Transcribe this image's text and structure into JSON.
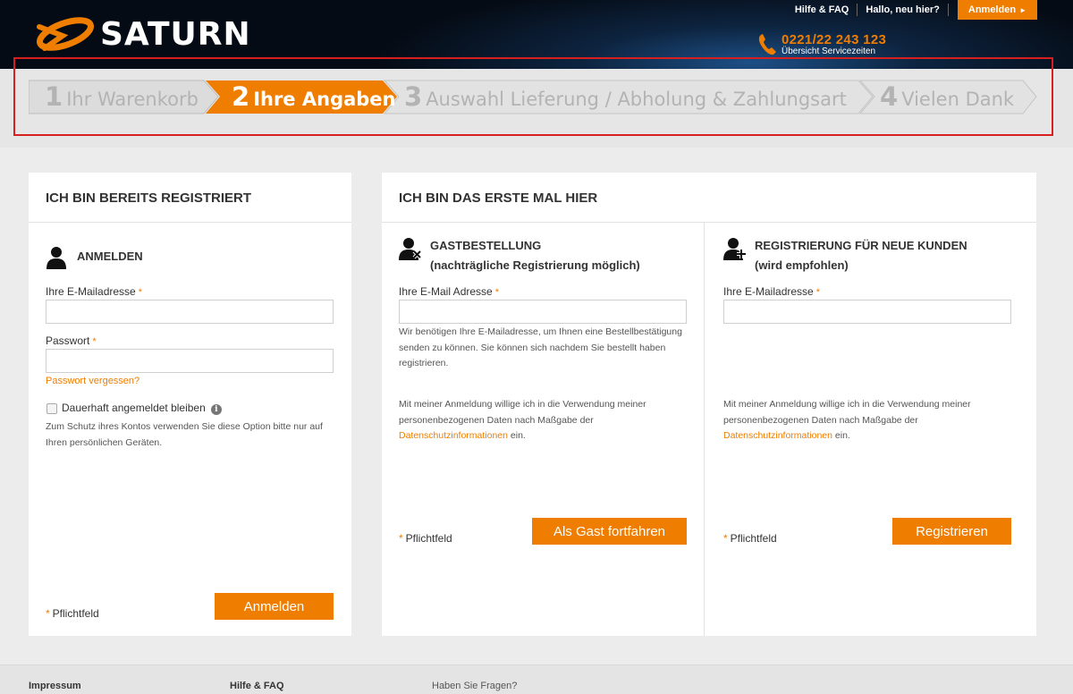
{
  "brand": {
    "name": "SATURN",
    "accent": "#ef7d00"
  },
  "header": {
    "links": {
      "help": "Hilfe & FAQ",
      "greeting": "Hallo, neu hier?"
    },
    "login_button": "Anmelden",
    "login_arrow": "►",
    "phone": {
      "icon": "phone-icon",
      "number": "0221/22 243 123",
      "subtitle": "Übersicht Servicezeiten"
    }
  },
  "steps": [
    {
      "num": "1",
      "label": "Ihr Warenkorb",
      "active": false
    },
    {
      "num": "2",
      "label": "Ihre Angaben",
      "active": true
    },
    {
      "num": "3",
      "label": "Auswahl Lieferung / Abholung & Zahlungsart",
      "active": false
    },
    {
      "num": "4",
      "label": "Vielen Dank",
      "active": false
    }
  ],
  "registered": {
    "title": "ICH BIN BEREITS REGISTRIERT",
    "section_title": "ANMELDEN",
    "icon": "user-icon",
    "email_label": "Ihre E-Mailadresse",
    "password_label": "Passwort",
    "required_mark": "*",
    "forgot": "Passwort vergessen?",
    "remember_label": "Dauerhaft angemeldet bleiben",
    "info_icon": "i",
    "remember_hint_1": "Zum Schutz ihres Kontos verwenden Sie diese Option bitte nur auf",
    "remember_hint_2": "Ihren persönlichen Geräten.",
    "required_note": "Pflichtfeld",
    "submit": "Anmelden"
  },
  "first_time": {
    "title": "ICH BIN DAS ERSTE MAL HIER",
    "guest": {
      "icon": "user-remove-icon",
      "title": "GASTBESTELLUNG",
      "subtitle": "(nachträgliche Registrierung möglich)",
      "email_label": "Ihre E-Mail Adresse",
      "hint_1": "Wir benötigen Ihre E-Mailadresse, um Ihnen eine Bestellbestätigung",
      "hint_2": "senden zu können. Sie können sich nachdem Sie bestellt haben",
      "hint_3": "registrieren.",
      "consent_1": "Mit meiner Anmeldung willige ich in die Verwendung meiner",
      "consent_2": "personenbezogenen Daten nach Maßgabe der",
      "consent_link": "Datenschutzinformationen",
      "consent_end": " ein.",
      "required_note": "Pflichtfeld",
      "submit": "Als Gast fortfahren"
    },
    "register": {
      "icon": "user-add-icon",
      "title": "REGISTRIERUNG FÜR NEUE KUNDEN",
      "subtitle": "(wird empfohlen)",
      "email_label": "Ihre E-Mailadresse",
      "consent_1": "Mit meiner Anmeldung willige ich in die Verwendung meiner",
      "consent_2": "personenbezogenen Daten nach Maßgabe der",
      "consent_link": "Datenschutzinformationen",
      "consent_end": " ein.",
      "required_note": "Pflichtfeld",
      "submit": "Registrieren"
    }
  },
  "footer": {
    "impressum": "Impressum",
    "help": "Hilfe & FAQ",
    "questions": "Haben Sie Fragen?"
  }
}
